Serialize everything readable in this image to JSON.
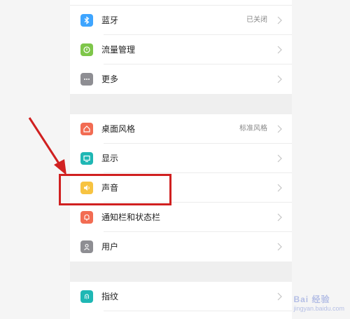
{
  "settings": {
    "items": [
      {
        "label": "蓝牙",
        "value": "已关闭",
        "icon": "bluetooth-icon",
        "color": "#3ea5ff"
      },
      {
        "label": "流量管理",
        "value": "",
        "icon": "data-usage-icon",
        "color": "#7ec64a"
      },
      {
        "label": "更多",
        "value": "",
        "icon": "more-icon",
        "color": "#8e8e93"
      },
      {
        "label": "桌面风格",
        "value": "标准风格",
        "icon": "home-icon",
        "color": "#f26c53"
      },
      {
        "label": "显示",
        "value": "",
        "icon": "display-icon",
        "color": "#1fb7b4"
      },
      {
        "label": "声音",
        "value": "",
        "icon": "sound-icon",
        "color": "#f7c341"
      },
      {
        "label": "通知栏和状态栏",
        "value": "",
        "icon": "notification-icon",
        "color": "#f26c53"
      },
      {
        "label": "用户",
        "value": "",
        "icon": "user-icon",
        "color": "#8e8e93"
      },
      {
        "label": "指纹",
        "value": "",
        "icon": "fingerprint-icon",
        "color": "#1fb7b4"
      }
    ]
  },
  "annotation": {
    "highlight_color": "#d02020"
  },
  "watermark": {
    "text": "Bai 经验",
    "sub": "jingyan.baidu.com"
  }
}
